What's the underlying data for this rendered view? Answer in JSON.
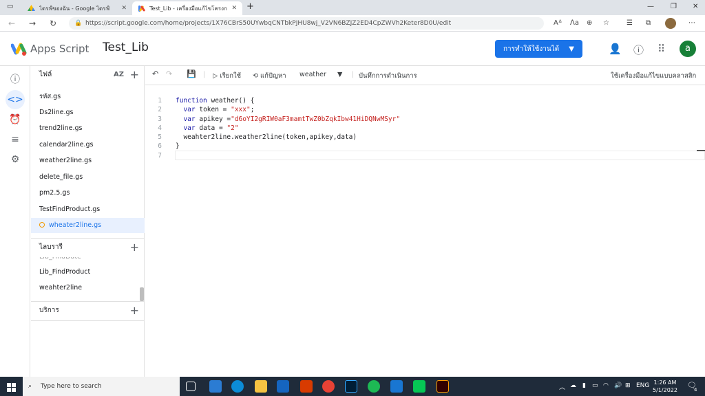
{
  "browser": {
    "tabs": [
      {
        "title": "ไดรฟ์ของฉัน - Google ไดรฟ์",
        "active": false
      },
      {
        "title": "Test_Lib - เครื่องมือแก้ไขโครงการ - A",
        "active": true
      }
    ],
    "url": "https://script.google.com/home/projects/1X76CBrS50UYwbqCNTbkPJHU8wj_V2VN6BZJZ2ED4CpZWVh2Keter8D0U/edit"
  },
  "header": {
    "app_name": "Apps Script",
    "project_name": "Test_Lib",
    "deploy_label": "การทำให้ใช้งานได้",
    "avatar_letter": "a",
    "deploy_color": "#1a73e8"
  },
  "files_panel": {
    "title": "ไฟล์",
    "sort_label": "AZ",
    "files": [
      {
        "name": "รหัส.gs",
        "active": false
      },
      {
        "name": "Ds2line.gs",
        "active": false
      },
      {
        "name": "trend2line.gs",
        "active": false
      },
      {
        "name": "calendar2line.gs",
        "active": false
      },
      {
        "name": "weather2line.gs",
        "active": false
      },
      {
        "name": "delete_file.gs",
        "active": false
      },
      {
        "name": "pm2.5.gs",
        "active": false
      },
      {
        "name": "TestFindProduct.gs",
        "active": false
      },
      {
        "name": "wheater2line.gs",
        "active": true
      }
    ]
  },
  "libraries": {
    "title": "ไลบรารี",
    "items": [
      "Lib_FindProduct",
      "weahter2line"
    ]
  },
  "services": {
    "title": "บริการ"
  },
  "toolbar": {
    "run_label": "เรียกใช้",
    "debug_label": "แก้ปัญหา",
    "function_select": "weather",
    "log_label": "บันทึกการดำเนินการ",
    "classic_label": "ใช้เครื่องมือแก้ไขแบบคลาสสิก"
  },
  "code": {
    "lines": [
      {
        "n": "1",
        "text": "function weather() {"
      },
      {
        "n": "2",
        "text": "  var token = \"xxx\";"
      },
      {
        "n": "3",
        "text": "  var apikey =\"d6oYI2gRIW0aF3mamtTwZ0bZqkIbw41HiDQNwMSyr\""
      },
      {
        "n": "4",
        "text": "  var data = \"2\""
      },
      {
        "n": "5",
        "text": "  weahter2line.weather2line(token,apikey,data)"
      },
      {
        "n": "6",
        "text": "}"
      },
      {
        "n": "7",
        "text": ""
      }
    ]
  },
  "taskbar": {
    "search_placeholder": "Type here to search",
    "lang": "ENG",
    "time": "1:26 AM",
    "date": "5/1/2022",
    "notification_count": "4"
  }
}
